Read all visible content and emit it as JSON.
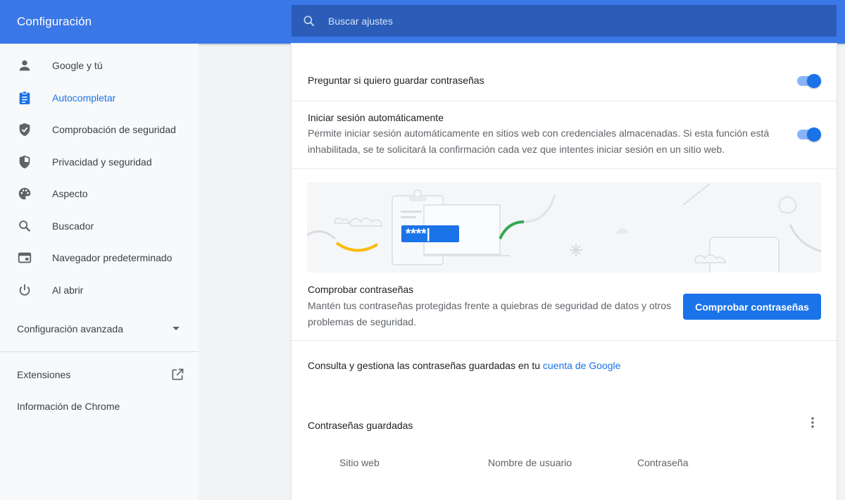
{
  "header": {
    "title": "Configuración",
    "search_placeholder": "Buscar ajustes",
    "search_icon": "search-icon"
  },
  "sidebar": {
    "items": [
      {
        "label": "Google y tú",
        "icon": "person-icon",
        "active": false
      },
      {
        "label": "Autocompletar",
        "icon": "clipboard-icon",
        "active": true
      },
      {
        "label": "Comprobación de seguridad",
        "icon": "shield-check-icon",
        "active": false
      },
      {
        "label": "Privacidad y seguridad",
        "icon": "shield-icon",
        "active": false
      },
      {
        "label": "Aspecto",
        "icon": "palette-icon",
        "active": false
      },
      {
        "label": "Buscador",
        "icon": "search-icon",
        "active": false
      },
      {
        "label": "Navegador predeterminado",
        "icon": "browser-icon",
        "active": false
      },
      {
        "label": "Al abrir",
        "icon": "power-icon",
        "active": false
      }
    ],
    "advanced_label": "Configuración avanzada",
    "extensions_label": "Extensiones",
    "about_label": "Información de Chrome"
  },
  "main": {
    "offer_save": {
      "label": "Preguntar si quiero guardar contraseñas",
      "enabled": true
    },
    "auto_signin": {
      "label": "Iniciar sesión automáticamente",
      "description": "Permite iniciar sesión automáticamente en sitios web con credenciales almacenadas. Si esta función está inhabilitada, se te solicitará la confirmación cada vez que intentes iniciar sesión en un sitio web.",
      "enabled": true
    },
    "illustration": {
      "password_mask": "****|"
    },
    "check": {
      "title": "Comprobar contraseñas",
      "description": "Mantén tus contraseñas protegidas frente a quiebras de seguridad de datos y otros problemas de seguridad.",
      "button_label": "Comprobar contraseñas"
    },
    "manage": {
      "prefix": "Consulta y gestiona las contraseñas guardadas en tu ",
      "link_label": "cuenta de Google"
    },
    "saved": {
      "title": "Contraseñas guardadas",
      "columns": [
        "Sitio web",
        "Nombre de usuario",
        "Contraseña"
      ]
    }
  },
  "colors": {
    "header": "#3b78e7",
    "search_bg": "#2a5cb8",
    "accent": "#1a73e8",
    "toggle_track": "#8ab4f8"
  }
}
